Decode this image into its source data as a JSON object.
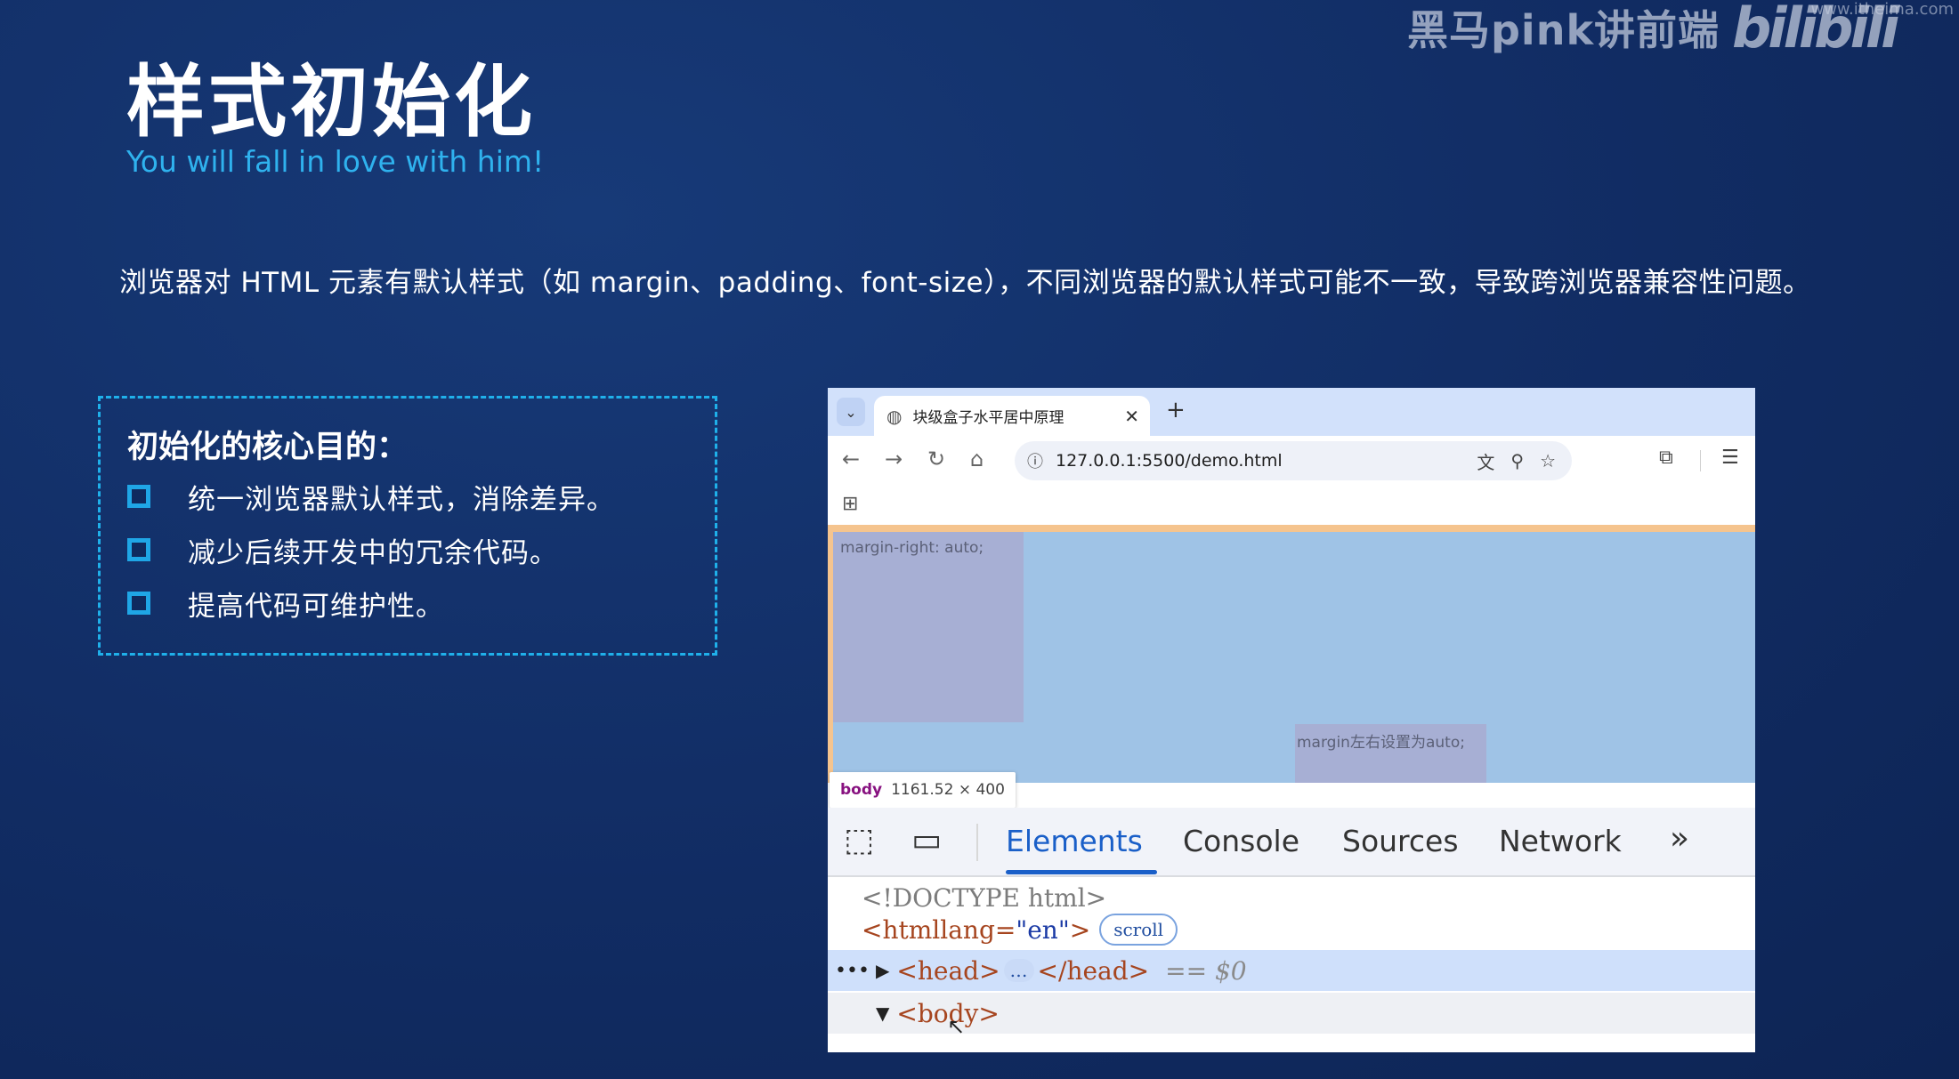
{
  "watermark": {
    "text": "黑马pink讲前端",
    "logo": "bilibili",
    "url": "www.itheima.com"
  },
  "slide": {
    "title": "样式初始化",
    "subtitle": "You will fall in love with him!",
    "description": "浏览器对 HTML 元素有默认样式（如 margin、padding、font-size），不同浏览器的默认样式可能不一致，导致跨浏览器兼容性问题。",
    "purpose": {
      "heading": "初始化的核心目的：",
      "items": [
        "统一浏览器默认样式，消除差异。",
        "减少后续开发中的冗余代码。",
        "提高代码可维护性。"
      ]
    }
  },
  "browser": {
    "tab_title": "块级盒子水平居中原理",
    "url": "127.0.0.1:5500/demo.html",
    "icons": {
      "tab_dropdown": "chevron-down-icon",
      "favicon": "globe-icon",
      "close": "close-icon",
      "new_tab": "plus-icon",
      "back": "arrow-left-icon",
      "forward": "arrow-right-icon",
      "reload": "reload-icon",
      "home": "home-icon",
      "site_info": "info-icon",
      "translate": "translate-icon",
      "zoom": "zoom-icon",
      "bookmark": "star-icon",
      "extensions": "puzzle-icon",
      "reading_list": "reading-list-icon",
      "apps": "apps-grid-icon"
    },
    "page": {
      "box1_label": "margin-right: auto;",
      "box2_label": "margin左右设置为auto;",
      "tooltip_tag": "body",
      "tooltip_dims": "1161.52 × 400"
    }
  },
  "devtools": {
    "tabs": [
      "Elements",
      "Console",
      "Sources",
      "Network"
    ],
    "active_tab": "Elements",
    "more": "»",
    "dom": {
      "doctype": "<!DOCTYPE html>",
      "html_open": "<html",
      "attr_name": " lang=",
      "attr_value": "\"en\"",
      "html_close": ">",
      "scroll_badge": "scroll",
      "head_open": "<head>",
      "ellipsis": "…",
      "head_close": "</head>",
      "selected_marker": "== $0",
      "body_open": "<body>"
    }
  },
  "colors": {
    "background": "#112c63",
    "accent": "#2fb2ee",
    "dashed_border": "#1fb0ea",
    "devtools_active": "#1a5fc8"
  }
}
